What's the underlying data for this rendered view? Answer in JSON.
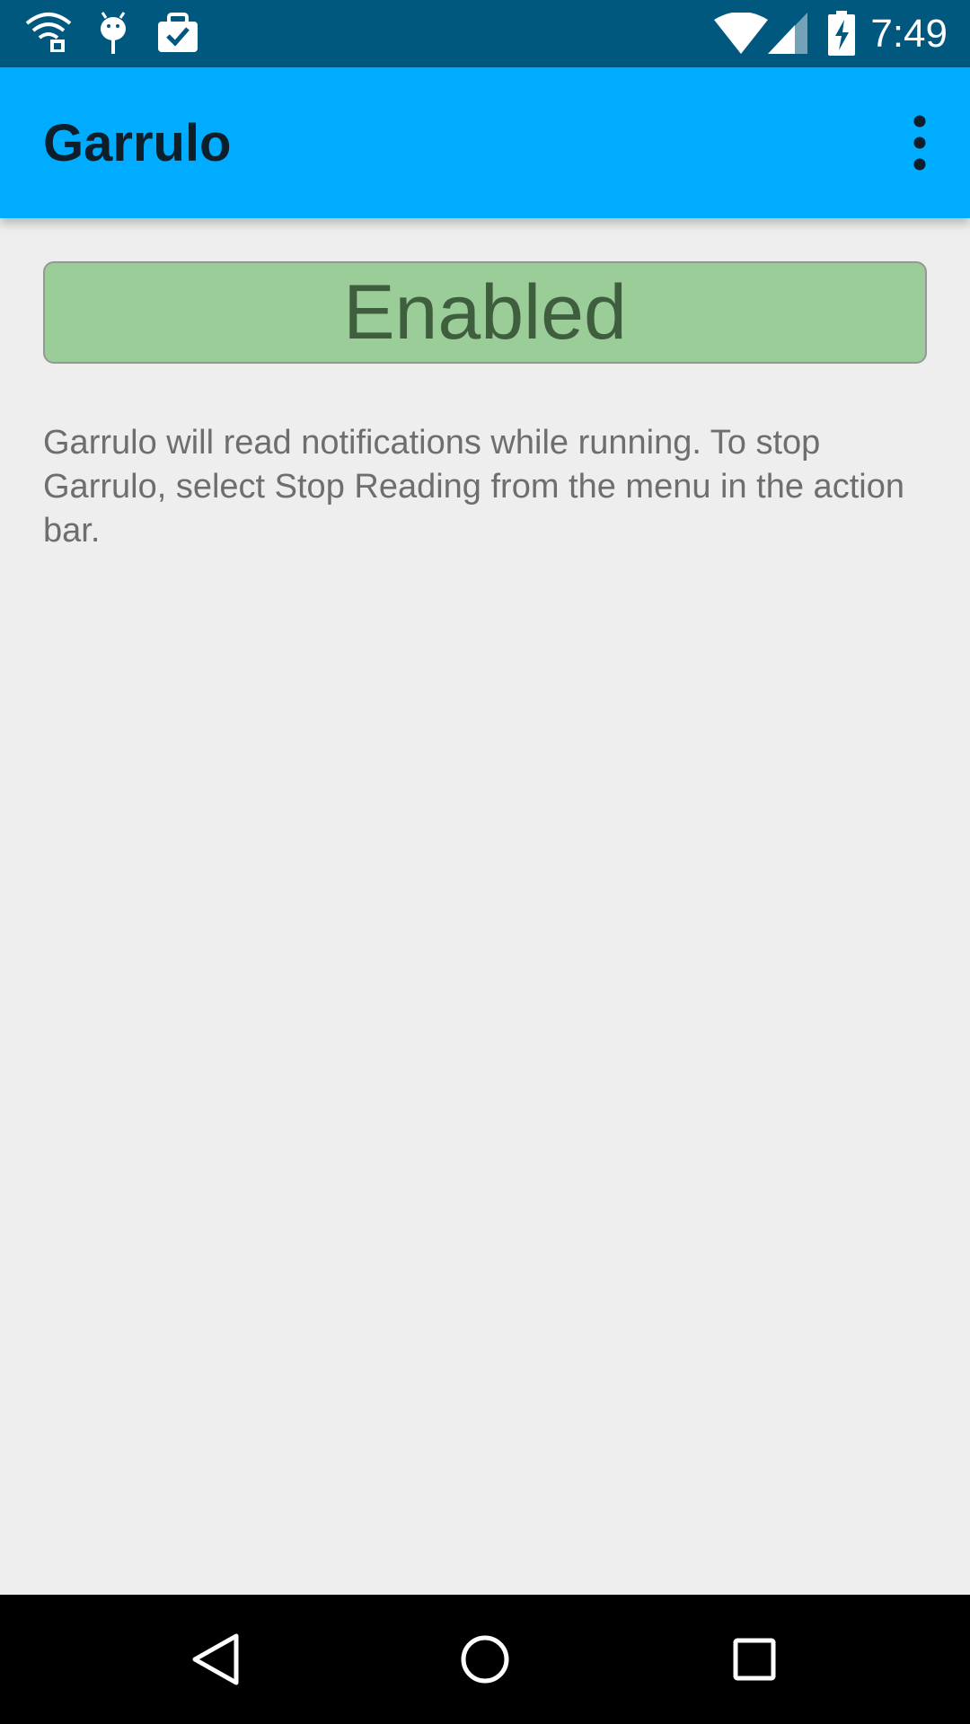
{
  "status_bar": {
    "time": "7:49",
    "left_icons": [
      "wifi-lock-icon",
      "android-debug-icon",
      "briefcase-check-icon"
    ],
    "right_icons": [
      "wifi-signal-icon",
      "cell-signal-icon",
      "battery-charging-icon"
    ]
  },
  "app_bar": {
    "title": "Garrulo",
    "overflow_icon": "more-vert-icon"
  },
  "main": {
    "status_button_label": "Enabled",
    "description": "Garrulo will read notifications while running. To stop Garrulo, select Stop Reading from the menu in the action bar."
  },
  "nav_bar": {
    "buttons": [
      "back-icon",
      "home-icon",
      "recents-icon"
    ]
  },
  "colors": {
    "status_bar": "#01587f",
    "app_bar": "#00acff",
    "status_button_bg": "#9bcd98",
    "status_button_text": "#3e5e3e",
    "background": "#eeeeee",
    "nav_bar": "#000000"
  }
}
